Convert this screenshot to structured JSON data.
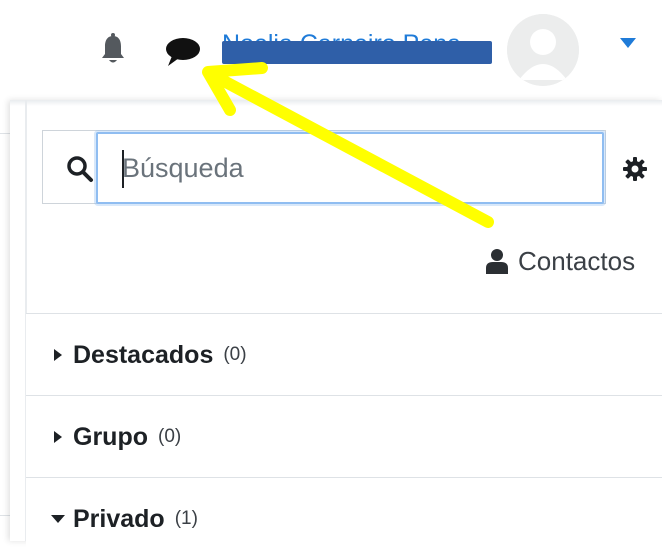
{
  "navbar": {
    "user_name": "Noelia Carneiro Pena",
    "icons": {
      "notifications": "bell-icon",
      "messages": "chat-bubble-icon",
      "menu": "caret-down-icon",
      "avatar": "user-avatar"
    }
  },
  "drawer": {
    "search": {
      "placeholder": "Búsqueda",
      "value": ""
    },
    "settings_icon": "gear-icon",
    "contacts_label": "Contactos",
    "sections": [
      {
        "title": "Destacados",
        "count": "(0)",
        "expanded": false
      },
      {
        "title": "Grupo",
        "count": "(0)",
        "expanded": false
      },
      {
        "title": "Privado",
        "count": "(1)",
        "expanded": true
      }
    ]
  },
  "annotation": {
    "color": "#ffff00",
    "points_to": "messages"
  },
  "colors": {
    "link": "#1f7bd8",
    "redaction": "#2f5fa8",
    "focus_border": "#8fbdf1",
    "arrow": "#ffff00"
  }
}
